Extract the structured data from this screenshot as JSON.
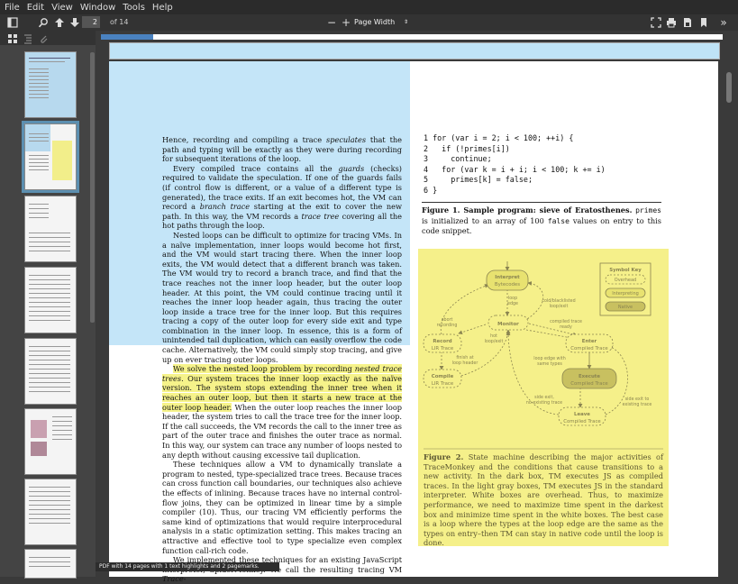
{
  "menubar": {
    "items": [
      "File",
      "Edit",
      "View",
      "Window",
      "Tools",
      "Help"
    ]
  },
  "toolbar": {
    "current_page": "2",
    "page_of": "of 14",
    "zoom_out": "−",
    "zoom_in": "+",
    "zoom_mode": "Page Width",
    "more": "»"
  },
  "icons": [
    "sidebar-toggle-icon",
    "search-icon",
    "up-arrow-icon",
    "down-arrow-icon",
    "fullscreen-icon",
    "print-icon",
    "save-icon",
    "bookmark-icon",
    "thumbnails-icon",
    "outline-icon",
    "attachments-icon"
  ],
  "document": {
    "left_column": {
      "p1_a": "Hence, recording and compiling a trace ",
      "p1_b": "speculates",
      "p1_c": " that the path and typing will be exactly as they were during recording for subsequent iterations of the loop.",
      "p2_a": "Every compiled trace contains all the ",
      "p2_b": "guards",
      "p2_c": " (checks) required to validate the speculation. If one of the guards fails (if control flow is different, or a value of a different type is generated), the trace exits. If an exit becomes hot, the VM can record a ",
      "p2_d": "branch trace",
      "p2_e": " starting at the exit to cover the new path. In this way, the VM records a ",
      "p2_f": "trace tree",
      "p2_g": " covering all the hot paths through the loop.",
      "p3": "Nested loops can be difficult to optimize for tracing VMs. In a naïve implementation, inner loops would become hot first, and the VM would start tracing there. When the inner loop exits, the VM would detect that a different branch was taken. The VM would try to record a branch trace, and find that the trace reaches not the inner loop header, but the outer loop header. At this point, the VM could continue tracing until it reaches the inner loop header again, thus tracing the outer loop inside a trace tree for the inner loop. But this requires tracing a copy of the outer loop for every side exit and type combination in the inner loop. In essence, this is a form of unintended tail duplication, which can easily overflow the code cache. Alternatively, the VM could simply stop tracing, and give up on ever tracing outer loops.",
      "p4_hl_a": "We solve the nested loop problem by recording ",
      "p4_hl_b": "nested trace trees",
      "p4_hl_c": ". Our system traces the inner loop exactly as the naïve version. The system stops extending the inner tree when it reaches an outer loop, but then it starts a new trace at the outer loop header.",
      "p4_rest": " When the outer loop reaches the inner loop header, the system tries to call the trace tree for the inner loop. If the call succeeds, the VM records the call to the inner tree as part of the outer trace and finishes the outer trace as normal. In this way, our system can trace any number of loops nested to any depth without causing excessive tail duplication.",
      "p5": "These techniques allow a VM to dynamically translate a program to nested, type-specialized trace trees. Because traces can cross function call boundaries, our techniques also achieve the effects of inlining. Because traces have no internal control-flow joins, they can be optimized in linear time by a simple compiler (10). Thus, our tracing VM efficiently performs the same kind of optimizations that would require interprocedural analysis in a static optimization setting. This makes tracing an attractive and effective tool to type specialize even complex function call-rich code.",
      "p6_a": "We implemented these techniques for an existing JavaScript interpreter, SpiderMonkey. We call the resulting tracing VM ",
      "p6_b": "Trace-"
    },
    "code_lines": [
      "1 for (var i = 2; i < 100; ++i) {",
      "2   if (!primes[i])",
      "3     continue;",
      "4   for (var k = i + i; i < 100; k += i)",
      "5     primes[k] = false;",
      "6 }"
    ],
    "figure1_caption": {
      "label": "Figure 1.  Sample program: sieve of Eratosthenes.",
      "text_a": " ",
      "code1": "primes",
      "text_b": " is initialized to an array of 100 ",
      "code2": "false",
      "text_c": " values on entry to this code snippet."
    },
    "figure2": {
      "nodes": {
        "interpret": [
          "Interpret",
          "Bytecodes"
        ],
        "monitor": [
          "Monitor"
        ],
        "record": [
          "Record",
          "LIR Trace"
        ],
        "enter": [
          "Enter",
          "Compiled Trace"
        ],
        "compile": [
          "Compile",
          "LIR Trace"
        ],
        "execute": [
          "Execute",
          "Compiled Trace"
        ],
        "leave": [
          "Leave",
          "Compiled Trace"
        ]
      },
      "edges": {
        "loop_edge": [
          "loop",
          "edge"
        ],
        "cold_blacklisted": [
          "cold/blacklisted",
          "loop/exit"
        ],
        "abort_recording": [
          "abort",
          "recording"
        ],
        "hot_loop": [
          "hot",
          "loop/exit"
        ],
        "compiled_ready": [
          "compiled trace",
          "ready"
        ],
        "finish_at": [
          "finish at",
          "loop header"
        ],
        "loop_same_types": [
          "loop edge with",
          "same types"
        ],
        "side_exit_no": [
          "side exit,",
          "no existing trace"
        ],
        "side_exit_to": [
          "side exit to",
          "existing trace"
        ]
      },
      "key": {
        "title": "Symbol Key",
        "overhead": "Overhead",
        "interpreting": "Interpreting",
        "native": "Native"
      },
      "caption_label": "Figure 2.",
      "caption_text": " State machine describing the major activities of TraceMonkey and the conditions that cause transitions to a new activity. In the dark box, TM executes JS as compiled traces. In the light gray boxes, TM executes JS in the standard interpreter. White boxes are overhead. Thus, to maximize performance, we need to maximize time spent in the darkest box and minimize time spent in the white boxes. The best case is a loop where the types at the loop edge are the same as the types on entry–then TM can stay in native code until the loop is done."
    }
  },
  "status": "PDF with 14 pages with 1 text highlights and 2 pagemarks.",
  "colors": {
    "blue_highlight": "#c4e5f8",
    "yellow_highlight": "#f6f38a",
    "progress": "#4a82c0"
  }
}
